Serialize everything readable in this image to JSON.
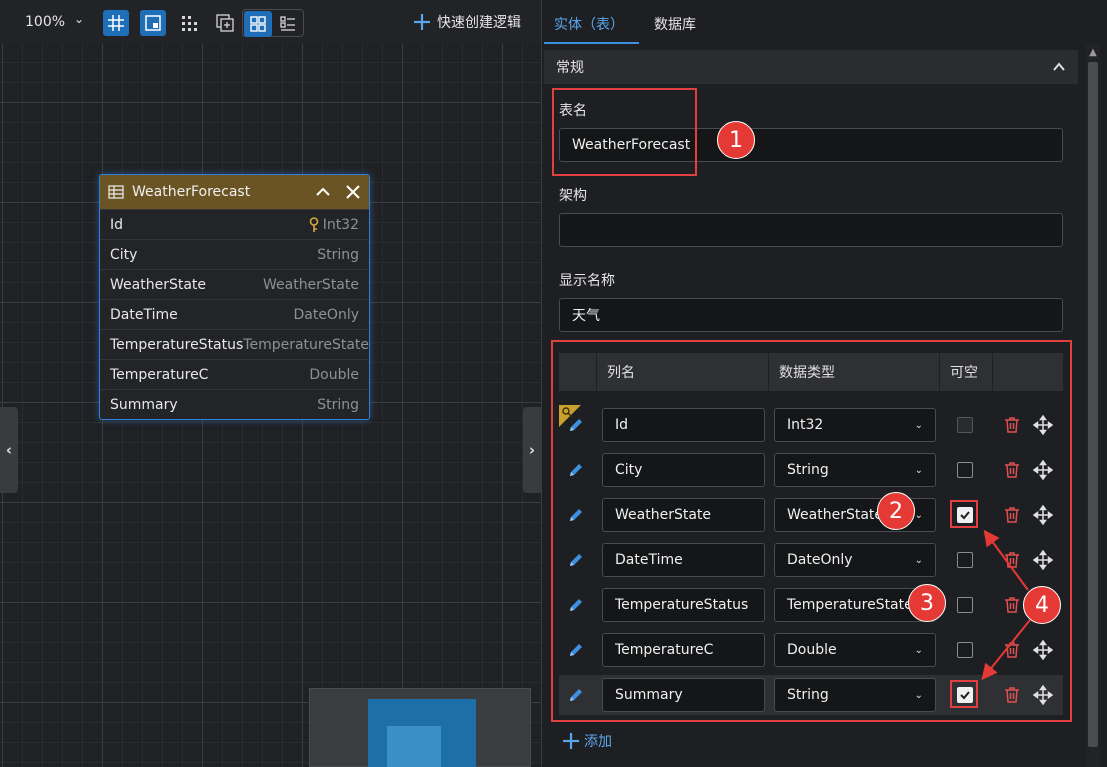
{
  "toolbar": {
    "zoom": "100%",
    "quick_create": "快速创建逻辑"
  },
  "entity_card": {
    "title": "WeatherForecast",
    "fields": [
      {
        "name": "Id",
        "type": "Int32",
        "key": true
      },
      {
        "name": "City",
        "type": "String"
      },
      {
        "name": "WeatherState",
        "type": "WeatherState"
      },
      {
        "name": "DateTime",
        "type": "DateOnly"
      },
      {
        "name": "TemperatureStatus",
        "type": "TemperatureState"
      },
      {
        "name": "TemperatureC",
        "type": "Double"
      },
      {
        "name": "Summary",
        "type": "String"
      }
    ]
  },
  "panel": {
    "tabs": [
      "实体（表）",
      "数据库"
    ],
    "section": "常规",
    "table_name_label": "表名",
    "table_name_value": "WeatherForecast",
    "schema_label": "架构",
    "schema_value": "",
    "display_name_label": "显示名称",
    "display_name_value": "天气",
    "grid_headers": [
      "列名",
      "数据类型",
      "可空"
    ],
    "rows": [
      {
        "name": "Id",
        "type": "Int32",
        "nullable": false,
        "disabled": true,
        "key": true
      },
      {
        "name": "City",
        "type": "String",
        "nullable": false
      },
      {
        "name": "WeatherState",
        "type": "WeatherState",
        "nullable": true
      },
      {
        "name": "DateTime",
        "type": "DateOnly",
        "nullable": false
      },
      {
        "name": "TemperatureStatus",
        "type": "TemperatureState",
        "nullable": false
      },
      {
        "name": "TemperatureC",
        "type": "Double",
        "nullable": false
      },
      {
        "name": "Summary",
        "type": "String",
        "nullable": true
      }
    ],
    "add_label": "添加"
  },
  "annotations": [
    "1",
    "2",
    "3",
    "4"
  ],
  "colors": {
    "accent": "#3d8fe0",
    "entity_header": "#6b5424",
    "annotation_red": "#e53935",
    "delete_red": "#e05050"
  }
}
